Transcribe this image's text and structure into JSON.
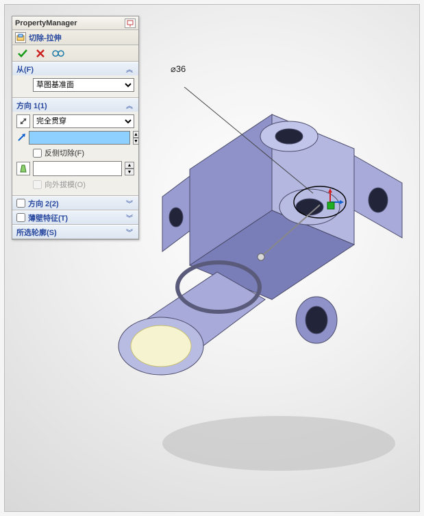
{
  "pm": {
    "title": "PropertyManager",
    "feature_name": "切除-拉伸",
    "sections": {
      "from": {
        "label": "从(F)",
        "value": "草图基准面"
      },
      "dir1": {
        "label": "方向 1(1)",
        "end_condition": "完全贯穿",
        "depth_value": "",
        "flip_side_label": "反侧切除(F)",
        "draft_on_label": "向外拔模(O)"
      },
      "dir2": {
        "label": "方向 2(2)"
      },
      "thin": {
        "label": "薄壁特征(T)"
      },
      "contours": {
        "label": "所选轮廓(S)"
      }
    }
  },
  "dimension": {
    "label": "⌀36"
  }
}
